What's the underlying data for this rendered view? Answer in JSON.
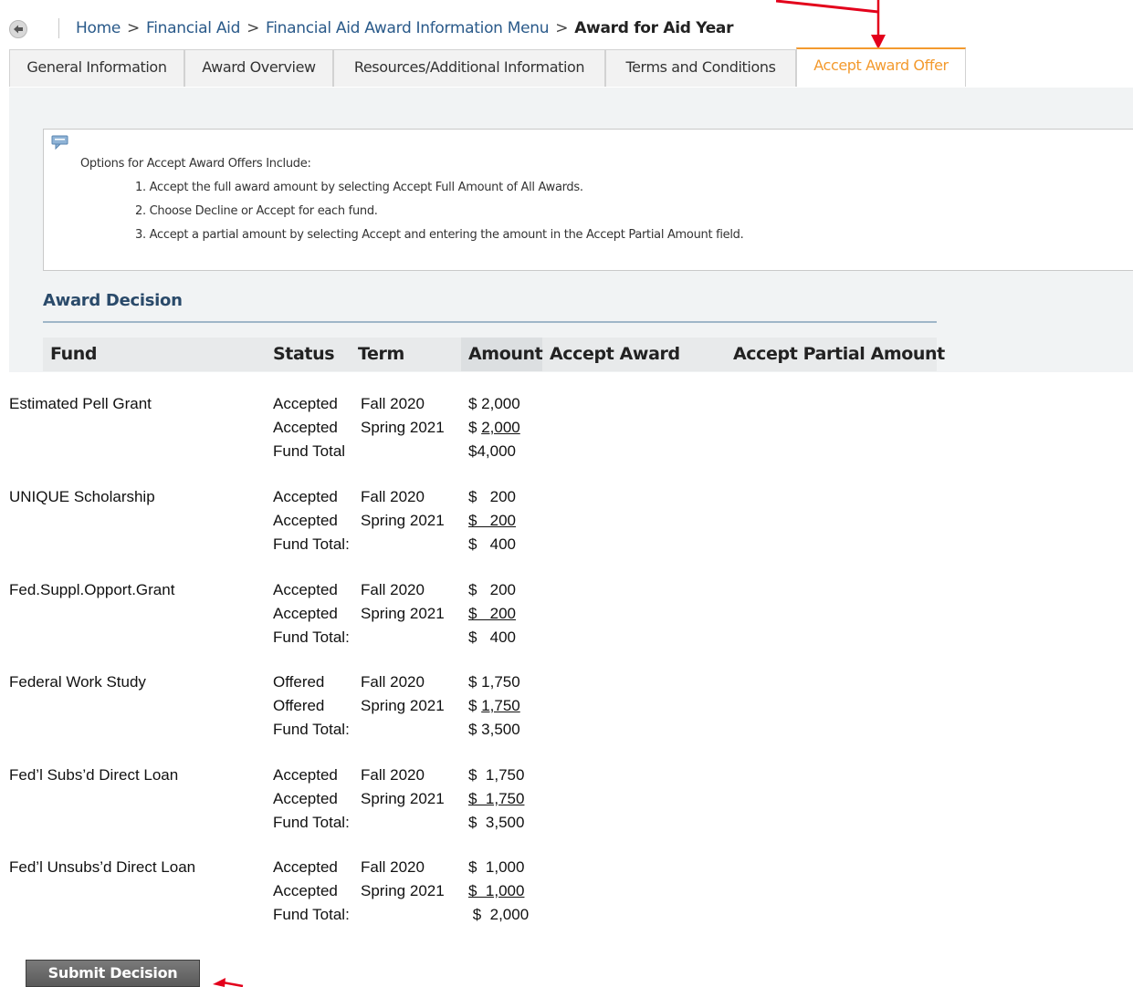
{
  "breadcrumb": {
    "items": [
      "Home",
      "Financial Aid",
      "Financial Aid Award Information Menu"
    ],
    "separator": ">",
    "current": "Award for Aid Year"
  },
  "tabs": [
    {
      "label": "General Information"
    },
    {
      "label": "Award Overview"
    },
    {
      "label": "Resources/Additional Information"
    },
    {
      "label": "Terms and Conditions"
    },
    {
      "label": "Accept Award Offer",
      "active": true
    }
  ],
  "info": {
    "intro": "Options for Accept Award Offers Include:",
    "options": [
      "1. Accept the full award amount by selecting Accept Full Amount of All Awards.",
      "2. Choose Decline or Accept for each fund.",
      "3. Accept a partial amount by selecting Accept and entering the amount in the Accept Partial Amount field."
    ]
  },
  "award_decision": {
    "heading": "Award Decision",
    "columns": [
      "Fund",
      "Status",
      "Term",
      "Amount",
      "Accept Award",
      "Accept Partial Amount"
    ]
  },
  "funds": [
    {
      "name": "Estimated Pell Grant",
      "rows": [
        {
          "status": "Accepted",
          "term": "Fall 2020",
          "amount": "$ 2,000"
        },
        {
          "status": "Accepted",
          "term": "Spring 2021",
          "amount_prefix": "$ ",
          "amount_u": "2,000"
        },
        {
          "status": "Fund Total",
          "term": "",
          "amount": "$4,000"
        }
      ]
    },
    {
      "name": "UNIQUE Scholarship",
      "rows": [
        {
          "status": "Accepted",
          "term": "Fall 2020",
          "amount": "$   200"
        },
        {
          "status": "Accepted",
          "term": "Spring 2021",
          "amount_u": "$   200"
        },
        {
          "status": "Fund Total:",
          "term": "",
          "amount": "$   400"
        }
      ]
    },
    {
      "name": "Fed.Suppl.Opport.Grant",
      "rows": [
        {
          "status": "Accepted",
          "term": "Fall 2020",
          "amount": "$   200"
        },
        {
          "status": "Accepted",
          "term": "Spring 2021",
          "amount_u": "$   200"
        },
        {
          "status": "Fund Total:",
          "term": "",
          "amount": "$   400"
        }
      ]
    },
    {
      "name": "Federal Work Study",
      "rows": [
        {
          "status": "Offered",
          "term": "Fall 2020",
          "amount": "$ 1,750"
        },
        {
          "status": "Offered",
          "term": "Spring 2021",
          "amount_prefix": "$ ",
          "amount_u": "1,750"
        },
        {
          "status": "Fund Total:",
          "term": "",
          "amount": "$ 3,500"
        }
      ]
    },
    {
      "name": "Fed’l Subs’d Direct Loan",
      "rows": [
        {
          "status": "Accepted",
          "term": "Fall 2020",
          "amount": "$  1,750"
        },
        {
          "status": "Accepted",
          "term": "Spring 2021",
          "amount_u": "$  1,750"
        },
        {
          "status": "Fund Total:",
          "term": "",
          "amount": "$  3,500"
        }
      ]
    },
    {
      "name": "Fed’l Unsubs’d Direct Loan",
      "rows": [
        {
          "status": "Accepted",
          "term": "Fall 2020",
          "amount": "$  1,000"
        },
        {
          "status": "Accepted",
          "term": "Spring 2021",
          "amount_u": "$  1,000"
        },
        {
          "status": "Fund Total:",
          "term": "",
          "amount": " $  2,000"
        }
      ]
    }
  ],
  "submit_label": "Submit Decision",
  "colors": {
    "accent_tab": "#f39a2e",
    "link": "#2a5a8a",
    "annotation_arrow": "#e3001b"
  }
}
